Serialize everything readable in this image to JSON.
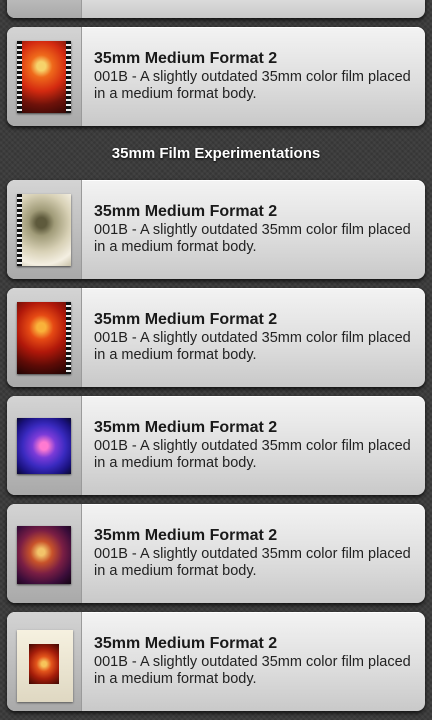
{
  "section": {
    "title": "35mm Film Experimentations"
  },
  "cards": [
    {
      "title": "35mm Medium Format 2",
      "description": "001B - A slightly outdated 35mm color film placed in a medium format body.",
      "thumb_icon": "film-thumbnail-orange-flower"
    },
    {
      "title": "35mm Medium Format 2",
      "description": "001B - A slightly outdated 35mm color film placed in a medium format body.",
      "thumb_icon": "film-thumbnail-sepia-flower"
    },
    {
      "title": "35mm Medium Format 2",
      "description": "001B - A slightly outdated 35mm color film placed in a medium format body.",
      "thumb_icon": "film-thumbnail-red-flower"
    },
    {
      "title": "35mm Medium Format 2",
      "description": "001B - A slightly outdated 35mm color film placed in a medium format body.",
      "thumb_icon": "film-thumbnail-purple-flower"
    },
    {
      "title": "35mm Medium Format 2",
      "description": "001B - A slightly outdated 35mm color film placed in a medium format body.",
      "thumb_icon": "film-thumbnail-violet-flower"
    },
    {
      "title": "35mm Medium Format 2",
      "description": "001B - A slightly outdated 35mm color film placed in a medium format body.",
      "thumb_icon": "film-thumbnail-framed-flower"
    }
  ]
}
